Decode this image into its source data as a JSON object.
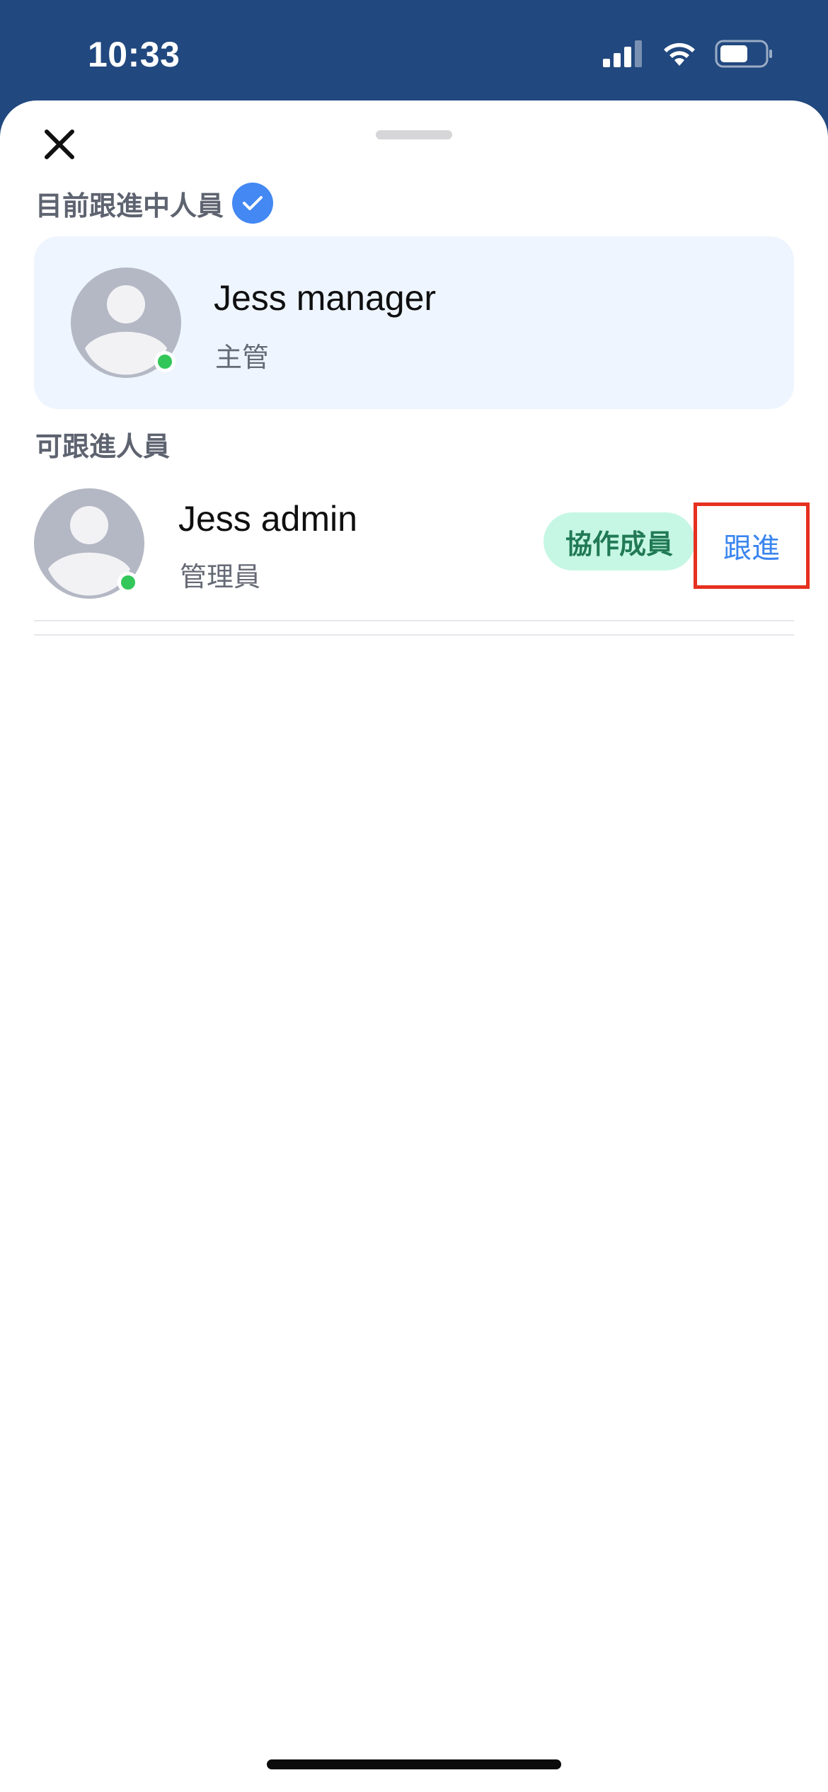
{
  "status_bar": {
    "time": "10:33",
    "icons": [
      "cellular-signal-icon",
      "wifi-icon",
      "battery-icon"
    ]
  },
  "sheet": {
    "close_icon": "close-icon",
    "current_section": {
      "title": "目前跟進中人員",
      "badge_icon": "check-icon",
      "person": {
        "name": "Jess manager",
        "role": "主管",
        "online": true
      }
    },
    "available_section": {
      "title": "可跟進人員",
      "members": [
        {
          "name": "Jess admin",
          "role": "管理員",
          "online": true,
          "badge": "協作成員",
          "action_label": "跟進"
        }
      ]
    }
  },
  "colors": {
    "header_bg": "#21487f",
    "accent_blue": "#4388f3",
    "card_bg": "#eef5fe",
    "badge_bg": "#c6f7e4",
    "badge_text": "#217a55",
    "online": "#33c759",
    "highlight": "#e6301f"
  }
}
